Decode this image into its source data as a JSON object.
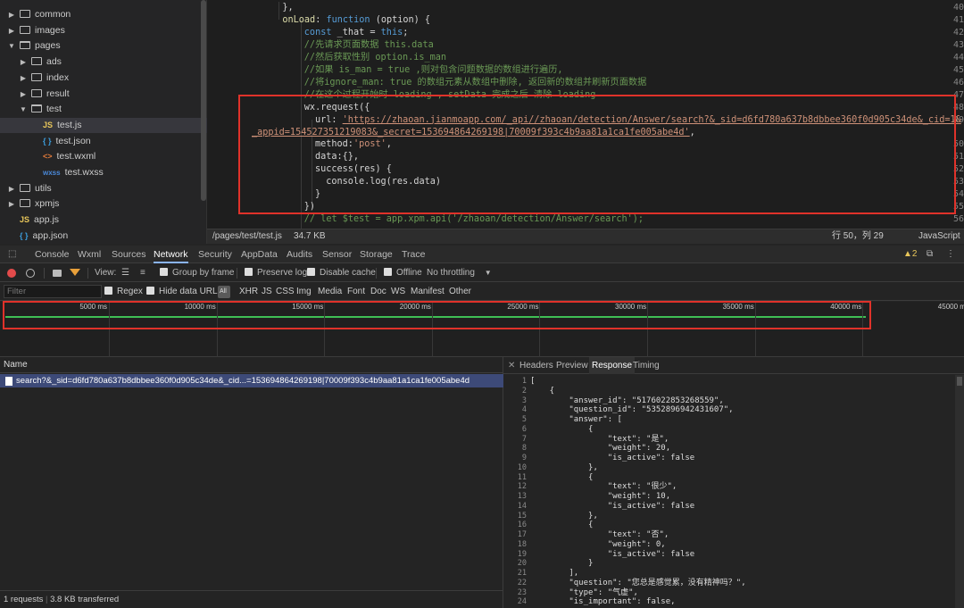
{
  "file_tree": [
    {
      "label": "common",
      "kind": "folder",
      "open": false,
      "depth": 0
    },
    {
      "label": "images",
      "kind": "folder",
      "open": false,
      "depth": 0
    },
    {
      "label": "pages",
      "kind": "folder",
      "open": true,
      "depth": 0
    },
    {
      "label": "ads",
      "kind": "folder",
      "open": false,
      "depth": 1
    },
    {
      "label": "index",
      "kind": "folder",
      "open": false,
      "depth": 1
    },
    {
      "label": "result",
      "kind": "folder",
      "open": false,
      "depth": 1
    },
    {
      "label": "test",
      "kind": "folder",
      "open": true,
      "depth": 1
    },
    {
      "label": "test.js",
      "kind": "js",
      "depth": 2,
      "selected": true
    },
    {
      "label": "test.json",
      "kind": "json",
      "depth": 2
    },
    {
      "label": "test.wxml",
      "kind": "wxml",
      "depth": 2
    },
    {
      "label": "test.wxss",
      "kind": "wxss",
      "depth": 2
    },
    {
      "label": "utils",
      "kind": "folder",
      "open": false,
      "depth": 0
    },
    {
      "label": "xpmjs",
      "kind": "folder",
      "open": false,
      "depth": 0
    },
    {
      "label": "app.js",
      "kind": "js",
      "depth": 0
    },
    {
      "label": "app.json",
      "kind": "json",
      "depth": 0
    }
  ],
  "editor": {
    "lines": [
      {
        "n": "40",
        "ind": 2,
        "parts": [
          [
            "",
            "},"
          ]
        ]
      },
      {
        "n": "41",
        "ind": 2,
        "parts": [
          [
            "fn",
            "onLoad"
          ],
          [
            "",
            ": "
          ],
          [
            "kw",
            "function"
          ],
          [
            "",
            " (option) {"
          ]
        ]
      },
      {
        "n": "42",
        "ind": 4,
        "parts": [
          [
            "kw",
            "const"
          ],
          [
            "",
            " _that = "
          ],
          [
            "kw",
            "this"
          ],
          [
            "",
            ";"
          ]
        ]
      },
      {
        "n": "43",
        "ind": 4,
        "parts": [
          [
            "cm",
            "//先请求页面数据 this.data"
          ]
        ]
      },
      {
        "n": "44",
        "ind": 4,
        "parts": [
          [
            "cm",
            "//然后获取性别 option.is_man"
          ]
        ]
      },
      {
        "n": "45",
        "ind": 4,
        "parts": [
          [
            "cm",
            "//如果 is_man = true ,则对包含问题数据的数组进行遍历,"
          ]
        ]
      },
      {
        "n": "46",
        "ind": 4,
        "parts": [
          [
            "cm",
            "//将ignore_man: true 的数组元素从数组中删除, 返回新的数组并刷新页面数据"
          ]
        ]
      },
      {
        "n": "47",
        "ind": 4,
        "parts": [
          [
            "cm",
            "//在这个过程开始时 loading , setData 完成之后 清除 loading"
          ]
        ]
      },
      {
        "n": "48",
        "ind": 4,
        "parts": [
          [
            "",
            "wx.request({"
          ]
        ]
      },
      {
        "n": "49",
        "ind": 5,
        "parts": [
          [
            "",
            "url: "
          ],
          [
            "url",
            "'https://zhaoan.jianmoapp.com/_api//zhaoan/detection/Answer/search?&_sid=d6fd780a637b8dbbee360f0d905c34de&_cid=1&"
          ]
        ]
      },
      {
        "n": "",
        "ind": 0,
        "parts": [
          [
            "url",
            "_appid=154527351219083&_secret=153694864269198|70009f393c4b9aa81a1ca1fe005abe4d'"
          ],
          [
            "",
            ","
          ]
        ]
      },
      {
        "n": "50",
        "ind": 5,
        "parts": [
          [
            "",
            "method:"
          ],
          [
            "str",
            "'post'"
          ],
          [
            "",
            ","
          ]
        ]
      },
      {
        "n": "51",
        "ind": 5,
        "parts": [
          [
            "",
            "data:{},"
          ]
        ]
      },
      {
        "n": "52",
        "ind": 5,
        "parts": [
          [
            "",
            "success(res) {"
          ]
        ]
      },
      {
        "n": "53",
        "ind": 6,
        "parts": [
          [
            "",
            "console.log(res.data)"
          ]
        ]
      },
      {
        "n": "54",
        "ind": 5,
        "parts": [
          [
            "",
            "}"
          ]
        ]
      },
      {
        "n": "55",
        "ind": 4,
        "parts": [
          [
            "",
            "})"
          ]
        ]
      },
      {
        "n": "56",
        "ind": 4,
        "parts": [
          [
            "cm",
            "// let $test = app.xpm.api('/zhaoan/detection/Answer/search');"
          ]
        ]
      }
    ]
  },
  "statusbar": {
    "path": "/pages/test/test.js",
    "size": "34.7 KB",
    "position": "行 50，列 29",
    "language": "JavaScript"
  },
  "devtools": {
    "tabs": [
      "Console",
      "Wxml",
      "Sources",
      "Network",
      "Security",
      "AppData",
      "Audits",
      "Sensor",
      "Storage",
      "Trace"
    ],
    "active_tab": "Network",
    "warning_count": "2"
  },
  "network_toolbar": {
    "view_label": "View:",
    "group_by_frame": "Group by frame",
    "preserve_log": "Preserve log",
    "disable_cache": "Disable cache",
    "offline": "Offline",
    "throttling": "No throttling"
  },
  "filter_bar": {
    "placeholder": "Filter",
    "regex": "Regex",
    "hide_data_urls": "Hide data URLs",
    "all_label": "All",
    "types": [
      "XHR",
      "JS",
      "CSS",
      "Img",
      "Media",
      "Font",
      "Doc",
      "WS",
      "Manifest",
      "Other"
    ]
  },
  "timeline": {
    "ticks": [
      "5000 ms",
      "10000 ms",
      "15000 ms",
      "20000 ms",
      "25000 ms",
      "30000 ms",
      "35000 ms",
      "40000 ms",
      "45000 ms"
    ]
  },
  "requests": {
    "header": "Name",
    "items": [
      "search?&_sid=d6fd780a637b8dbbee360f0d905c34de&_cid...=153694864269198|70009f393c4b9aa81a1ca1fe005abe4d"
    ],
    "footer_count": "1 requests",
    "footer_transfer": "3.8 KB transferred"
  },
  "detail_tabs": [
    "Headers",
    "Preview",
    "Response",
    "Timing"
  ],
  "detail_active": "Response",
  "response": [
    {
      "n": "1",
      "t": "["
    },
    {
      "n": "2",
      "t": "    {"
    },
    {
      "n": "3",
      "t": "        \"answer_id\": \"5176022853268559\","
    },
    {
      "n": "4",
      "t": "        \"question_id\": \"5352896942431607\","
    },
    {
      "n": "5",
      "t": "        \"answer\": ["
    },
    {
      "n": "6",
      "t": "            {"
    },
    {
      "n": "7",
      "t": "                \"text\": \"是\","
    },
    {
      "n": "8",
      "t": "                \"weight\": 20,"
    },
    {
      "n": "9",
      "t": "                \"is_active\": false"
    },
    {
      "n": "10",
      "t": "            },"
    },
    {
      "n": "11",
      "t": "            {"
    },
    {
      "n": "12",
      "t": "                \"text\": \"很少\","
    },
    {
      "n": "13",
      "t": "                \"weight\": 10,"
    },
    {
      "n": "14",
      "t": "                \"is_active\": false"
    },
    {
      "n": "15",
      "t": "            },"
    },
    {
      "n": "16",
      "t": "            {"
    },
    {
      "n": "17",
      "t": "                \"text\": \"否\","
    },
    {
      "n": "18",
      "t": "                \"weight\": 0,"
    },
    {
      "n": "19",
      "t": "                \"is_active\": false"
    },
    {
      "n": "20",
      "t": "            }"
    },
    {
      "n": "21",
      "t": "        ],"
    },
    {
      "n": "22",
      "t": "        \"question\": \"您总是感觉累，没有精神吗？\","
    },
    {
      "n": "23",
      "t": "        \"type\": \"气虚\","
    },
    {
      "n": "24",
      "t": "        \"is_important\": false,"
    }
  ],
  "colors": {
    "highlight_box": "#e0322a",
    "timeline_bar": "#3fbf55",
    "selected_row": "#3d4a78"
  }
}
